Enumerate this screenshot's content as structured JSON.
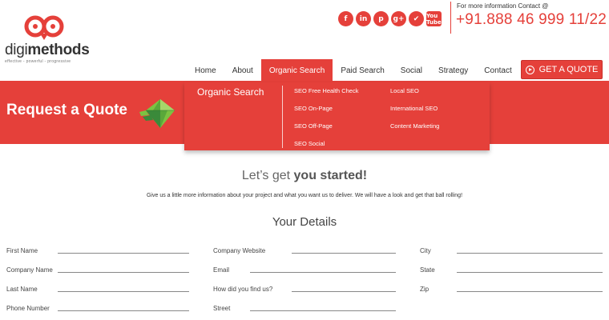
{
  "brand": {
    "logo_text_light": "digi",
    "logo_text_bold": "methods",
    "tagline": "effective - powerful - progressive"
  },
  "social_icons": [
    {
      "icon": "facebook-icon",
      "glyph": "f"
    },
    {
      "icon": "linkedin-icon",
      "glyph": "in"
    },
    {
      "icon": "pinterest-icon",
      "glyph": "p"
    },
    {
      "icon": "google-plus-icon",
      "glyph": "g+"
    },
    {
      "icon": "bird-icon",
      "glyph": "✔"
    },
    {
      "icon": "youtube-icon",
      "glyph": "You Tube"
    }
  ],
  "contact": {
    "label": "For more information Contact @",
    "phone": "+91.888 46 999 11/22"
  },
  "nav": {
    "items": [
      "Home",
      "About",
      "Organic Search",
      "Paid Search",
      "Social",
      "Strategy",
      "Contact"
    ],
    "active": "Organic Search"
  },
  "quote_button": {
    "label": "GET A QUOTE",
    "icon": "play-circle-icon"
  },
  "dropdown": {
    "title": "Organic Search",
    "col1": [
      "SEO Free Health Check",
      "SEO On-Page",
      "SEO Off-Page",
      "SEO Social"
    ],
    "col2": [
      "Local SEO",
      "International SEO",
      "Content Marketing"
    ]
  },
  "banner": {
    "title": "Request a Quote",
    "icon": "diamond-gem-icon"
  },
  "content": {
    "lets_light": "Let’s get ",
    "lets_bold": "you started!",
    "intro": "Give us a little more information about your project and what you want us to deliver. We will have a look and get that ball rolling!",
    "details_heading": "Your Details"
  },
  "form": {
    "fields": [
      "First Name",
      "Company Name",
      "Last Name",
      "Phone Number",
      "Company Website",
      "Email",
      "How did you find us?",
      "Street",
      "City",
      "State",
      "Zip"
    ]
  },
  "colors": {
    "accent": "#e5403a",
    "gem_green": "#7cc242",
    "gem_dark": "#3a8a3a"
  }
}
